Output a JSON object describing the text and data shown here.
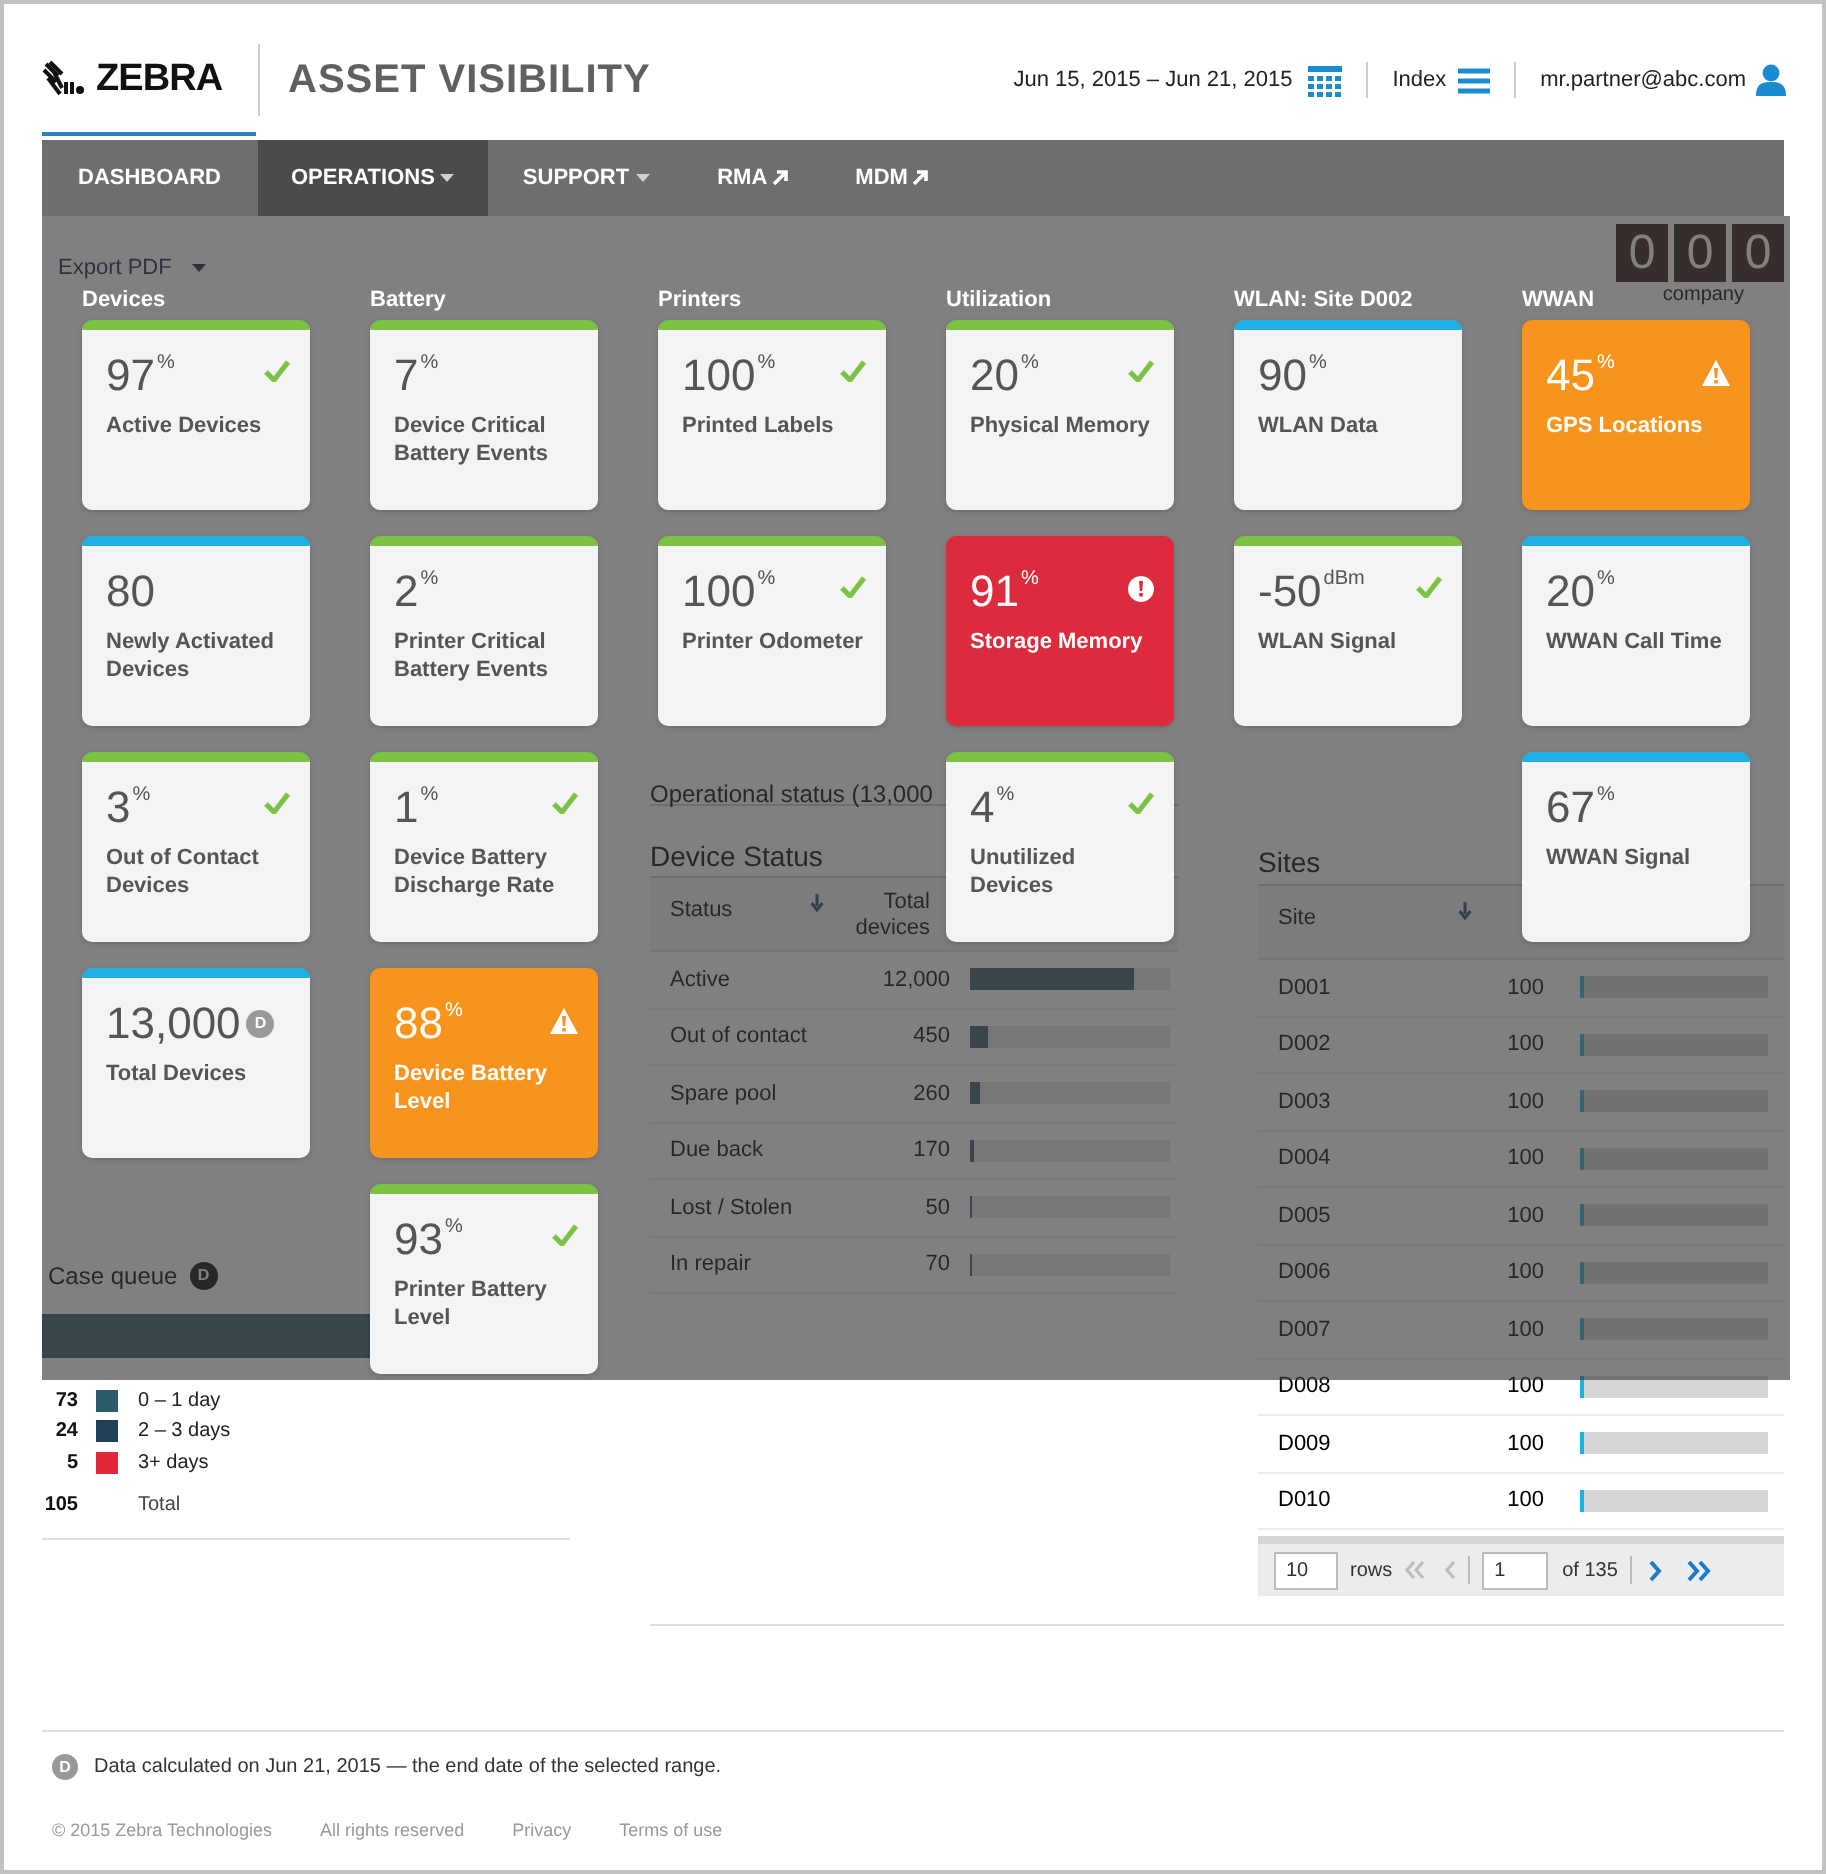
{
  "header": {
    "logo": "ZEBRA",
    "app_title": "ASSET VISIBILITY",
    "date_range": "Jun 15, 2015 – Jun 21, 2015",
    "index_label": "Index",
    "user": "mr.partner@abc.com"
  },
  "nav": [
    {
      "label": "DASHBOARD",
      "selected": false,
      "kind": "plain"
    },
    {
      "label": "OPERATIONS",
      "selected": true,
      "kind": "dropdown"
    },
    {
      "label": "SUPPORT",
      "selected": false,
      "kind": "dropdown"
    },
    {
      "label": "RMA",
      "selected": false,
      "kind": "external"
    },
    {
      "label": "MDM",
      "selected": false,
      "kind": "external"
    }
  ],
  "dashboard": {
    "export_label": "Export PDF",
    "counter": {
      "digits": [
        "0",
        "0",
        "0"
      ],
      "label": "company"
    },
    "case_queue": {
      "title": "Case queue",
      "badge": "D",
      "legend": [
        {
          "count": "73",
          "label": "0 – 1 day",
          "color": "#2e5b6c"
        },
        {
          "count": "24",
          "label": "2 – 3 days",
          "color": "#223f58"
        },
        {
          "count": "5",
          "label": "3+ days",
          "color": "#e0283a"
        }
      ],
      "total": {
        "count": "105",
        "label": "Total"
      }
    },
    "operational_status": "Operational status (13,000",
    "device_status": {
      "title": "Device Status",
      "columns": [
        "Status",
        "Total devices"
      ],
      "rows": [
        {
          "status": "Active",
          "total": "12,000",
          "level": 0.82
        },
        {
          "status": "Out of contact",
          "total": "450",
          "level": 0.09
        },
        {
          "status": "Spare pool",
          "total": "260",
          "level": 0.05
        },
        {
          "status": "Due back",
          "total": "170",
          "level": 0.02
        },
        {
          "status": "Lost / Stolen",
          "total": "50",
          "level": 0.01
        },
        {
          "status": "In repair",
          "total": "70",
          "level": 0.01
        }
      ]
    },
    "sites": {
      "title": "Sites",
      "columns": [
        "Site"
      ],
      "rows": [
        {
          "site": "D001",
          "total": "100",
          "level": 0.01
        },
        {
          "site": "D002",
          "total": "100",
          "level": 0.01
        },
        {
          "site": "D003",
          "total": "100",
          "level": 0.01
        },
        {
          "site": "D004",
          "total": "100",
          "level": 0.01
        },
        {
          "site": "D005",
          "total": "100",
          "level": 0.01
        },
        {
          "site": "D006",
          "total": "100",
          "level": 0.01
        },
        {
          "site": "D007",
          "total": "100",
          "level": 0.01
        },
        {
          "site": "D008",
          "total": "100",
          "level": 0.01
        },
        {
          "site": "D009",
          "total": "100",
          "level": 0.01
        },
        {
          "site": "D010",
          "total": "100",
          "level": 0.01
        }
      ],
      "pagination": {
        "rows_value": "10",
        "rows_label": "rows",
        "page_value": "1",
        "of_label": "of 135"
      }
    }
  },
  "menu": [
    {
      "title": "Devices",
      "cards": [
        {
          "value": "97",
          "unit": "%",
          "label": "Active Devices",
          "kind": "ok"
        },
        {
          "value": "80",
          "label": "Newly Activated Devices",
          "kind": "info"
        },
        {
          "value": "3",
          "unit": "%",
          "label": "Out of Contact Devices",
          "kind": "ok"
        },
        {
          "value": "13,000",
          "badge": "D",
          "label": "Total Devices",
          "kind": "info"
        }
      ]
    },
    {
      "title": "Battery",
      "cards": [
        {
          "value": "7",
          "unit": "%",
          "label": "Device Critical Battery Events",
          "kind": "normal"
        },
        {
          "value": "2",
          "unit": "%",
          "label": "Printer Critical Battery Events",
          "kind": "normal"
        },
        {
          "value": "1",
          "unit": "%",
          "label": "Device Battery Discharge Rate",
          "kind": "ok"
        },
        {
          "value": "88",
          "unit": "%",
          "label": "Device Battery Level",
          "kind": "warning"
        },
        {
          "value": "93",
          "unit": "%",
          "label": "Printer Battery Level",
          "kind": "ok"
        }
      ]
    },
    {
      "title": "Printers",
      "cards": [
        {
          "value": "100",
          "unit": "%",
          "label": "Printed Labels",
          "kind": "ok"
        },
        {
          "value": "100",
          "unit": "%",
          "label": "Printer Odometer",
          "kind": "ok"
        }
      ]
    },
    {
      "title": "Utilization",
      "cards": [
        {
          "value": "20",
          "unit": "%",
          "label": "Physical Memory",
          "kind": "ok"
        },
        {
          "value": "91",
          "unit": "%",
          "label": "Storage Memory",
          "kind": "critical"
        },
        {
          "value": "4",
          "unit": "%",
          "label": "Unutilized Devices",
          "kind": "ok"
        }
      ]
    },
    {
      "title": "WLAN: Site D002",
      "cards": [
        {
          "value": "90",
          "unit": "%",
          "label": "WLAN Data",
          "kind": "info"
        },
        {
          "value": "-50",
          "unit": "dBm",
          "label": "WLAN Signal",
          "kind": "ok"
        }
      ]
    },
    {
      "title": "WWAN",
      "cards": [
        {
          "value": "45",
          "unit": "%",
          "label": "GPS Locations",
          "kind": "warning"
        },
        {
          "value": "20",
          "unit": "%",
          "label": "WWAN Call Time",
          "kind": "info"
        },
        {
          "value": "67",
          "unit": "%",
          "label": "WWAN Signal",
          "kind": "info"
        }
      ]
    }
  ],
  "footer": {
    "note_badge": "D",
    "note": "Data calculated on Jun 21, 2015 — the end date of the selected range.",
    "links": [
      "© 2015 Zebra Technologies",
      "All rights reserved",
      "Privacy",
      "Terms of use"
    ]
  }
}
